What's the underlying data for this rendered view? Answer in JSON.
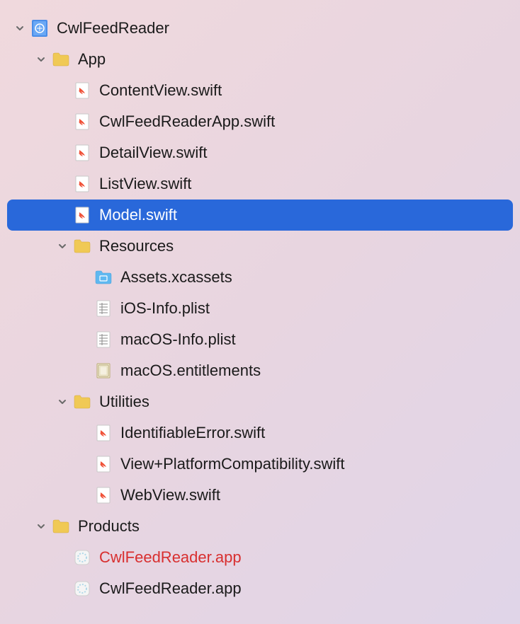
{
  "tree": {
    "project": {
      "name": "CwlFeedReader",
      "expanded": true
    },
    "app_group": {
      "name": "App",
      "expanded": true
    },
    "app_files": {
      "content_view": "ContentView.swift",
      "app_swift": "CwlFeedReaderApp.swift",
      "detail_view": "DetailView.swift",
      "list_view": "ListView.swift",
      "model": "Model.swift"
    },
    "resources_group": {
      "name": "Resources",
      "expanded": true
    },
    "resources_files": {
      "assets": "Assets.xcassets",
      "ios_plist": "iOS-Info.plist",
      "macos_plist": "macOS-Info.plist",
      "entitlements": "macOS.entitlements"
    },
    "utilities_group": {
      "name": "Utilities",
      "expanded": true
    },
    "utilities_files": {
      "identifiable_error": "IdentifiableError.swift",
      "view_platform": "View+PlatformCompatibility.swift",
      "web_view": "WebView.swift"
    },
    "products_group": {
      "name": "Products",
      "expanded": true
    },
    "products_files": {
      "app_missing": "CwlFeedReader.app",
      "app_built": "CwlFeedReader.app"
    }
  }
}
